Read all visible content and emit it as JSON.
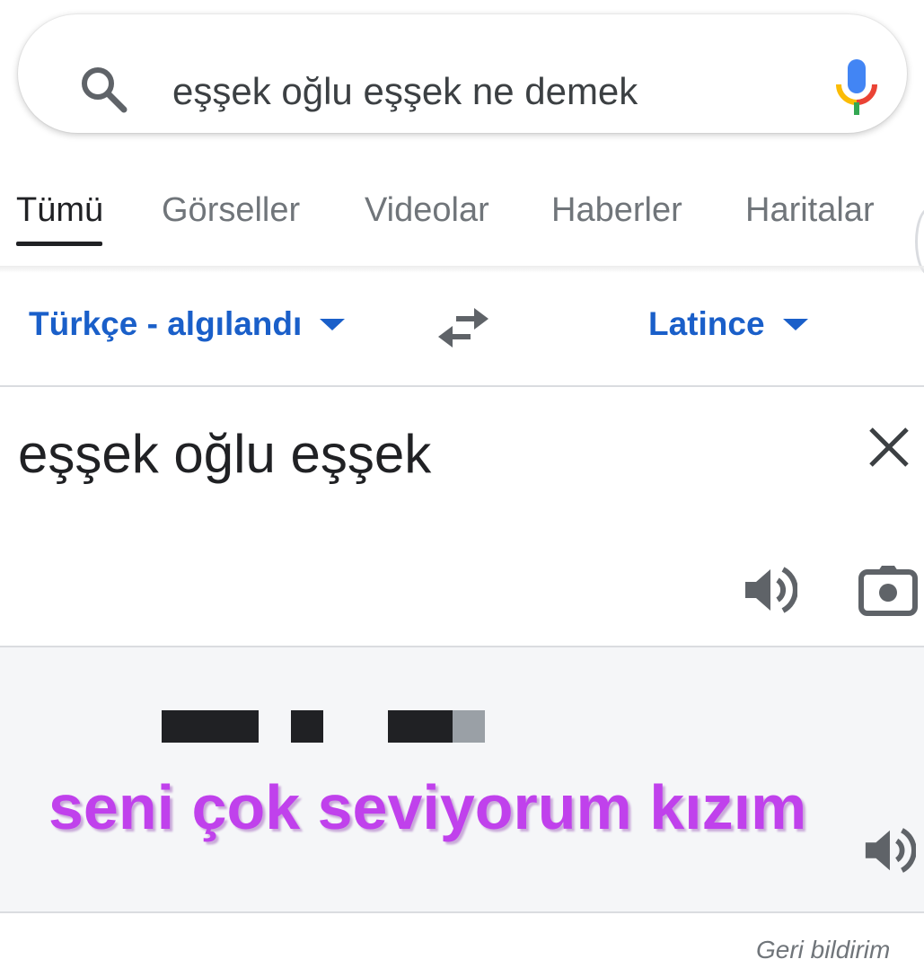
{
  "search": {
    "query": "eşşek oğlu eşşek ne demek",
    "search_icon": "search-icon",
    "mic_icon": "mic-icon"
  },
  "tabs": [
    {
      "label": "Tümü",
      "active": true
    },
    {
      "label": "Görseller",
      "active": false
    },
    {
      "label": "Videolar",
      "active": false
    },
    {
      "label": "Haberler",
      "active": false
    },
    {
      "label": "Haritalar",
      "active": false
    }
  ],
  "translator": {
    "source_language": "Türkçe - algılandı",
    "target_language": "Latince",
    "swap_icon": "swap-icon",
    "source_text": "eşşek oğlu eşşek",
    "result_overlay_text": "seni çok seviyorum kızım",
    "feedback_label": "Geri bildirim"
  },
  "colors": {
    "link_blue": "#1a5fc9",
    "overlay_purple": "#c041ec",
    "redaction": "#202124",
    "result_bg": "#f5f6f8"
  }
}
